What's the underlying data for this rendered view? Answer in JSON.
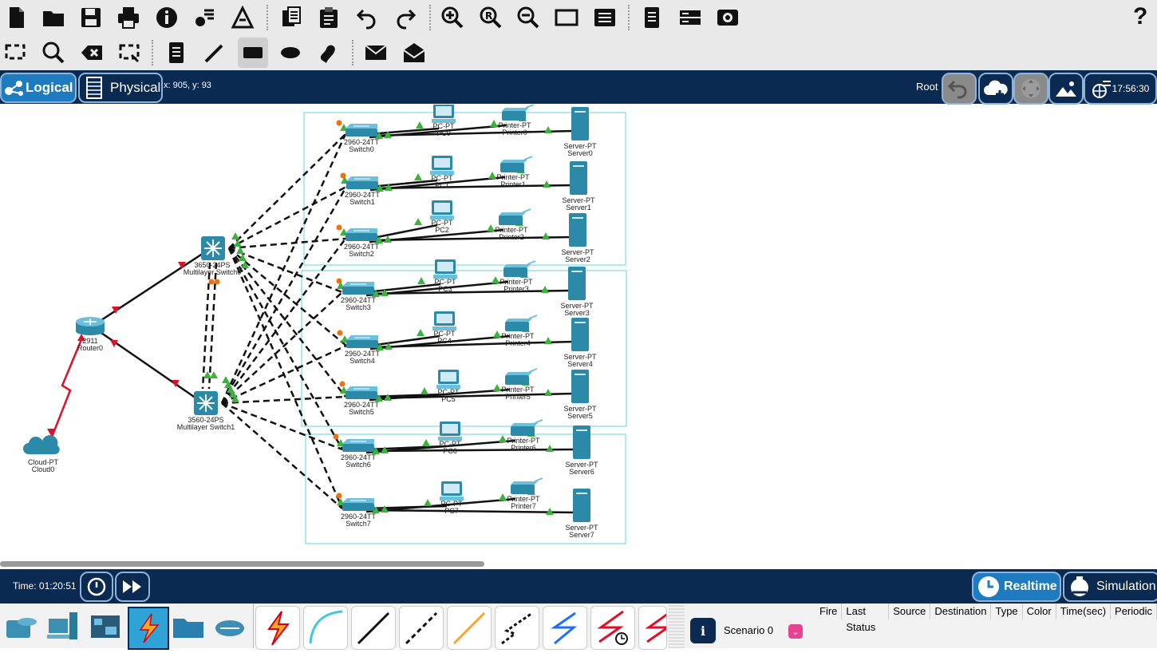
{
  "toolbar1": {
    "help_label": "?"
  },
  "topbar": {
    "logical_label": "Logical",
    "physical_label": "Physical",
    "coords": "x: 905, y: 93",
    "root_label": "Root",
    "clock": "17:56:30"
  },
  "devices": [
    {
      "id": "switch0",
      "model": "2960-24TT",
      "name": "Switch0"
    },
    {
      "id": "switch1",
      "model": "2960-24TT",
      "name": "Switch1"
    },
    {
      "id": "switch2",
      "model": "2960-24TT",
      "name": "Switch2"
    },
    {
      "id": "switch3",
      "model": "2960-24TT",
      "name": "Switch3"
    },
    {
      "id": "switch4",
      "model": "2960-24TT",
      "name": "Switch4"
    },
    {
      "id": "switch5",
      "model": "2960-24TT",
      "name": "Switch5"
    },
    {
      "id": "switch6",
      "model": "2960-24TT",
      "name": "Switch6"
    },
    {
      "id": "switch7",
      "model": "2960-24TT",
      "name": "Switch7"
    },
    {
      "id": "pc0",
      "model": "PC-PT",
      "name": "PC0"
    },
    {
      "id": "pc1",
      "model": "PC-PT",
      "name": "PC1"
    },
    {
      "id": "pc2",
      "model": "PC-PT",
      "name": "PC2"
    },
    {
      "id": "pc3",
      "model": "PC-PT",
      "name": "PC3"
    },
    {
      "id": "pc4",
      "model": "PC-PT",
      "name": "PC4"
    },
    {
      "id": "pc5",
      "model": "PC-PT",
      "name": "PC5"
    },
    {
      "id": "pc6",
      "model": "PC-PT",
      "name": "PC6"
    },
    {
      "id": "pc7",
      "model": "PC-PT",
      "name": "PC7"
    },
    {
      "id": "printer0",
      "model": "Printer-PT",
      "name": "Printer0"
    },
    {
      "id": "printer1",
      "model": "Printer-PT",
      "name": "Printer1"
    },
    {
      "id": "printer2",
      "model": "Printer-PT",
      "name": "Printer2"
    },
    {
      "id": "printer3",
      "model": "Printer-PT",
      "name": "Printer3"
    },
    {
      "id": "printer4",
      "model": "Printer-PT",
      "name": "Printer4"
    },
    {
      "id": "printer5",
      "model": "Printer-PT",
      "name": "Printer5"
    },
    {
      "id": "printer6",
      "model": "Printer-PT",
      "name": "Printer6"
    },
    {
      "id": "printer7",
      "model": "Printer-PT",
      "name": "Printer7"
    },
    {
      "id": "server0",
      "model": "Server-PT",
      "name": "Server0"
    },
    {
      "id": "server1",
      "model": "Server-PT",
      "name": "Server1"
    },
    {
      "id": "server2",
      "model": "Server-PT",
      "name": "Server2"
    },
    {
      "id": "server3",
      "model": "Server-PT",
      "name": "Server3"
    },
    {
      "id": "server4",
      "model": "Server-PT",
      "name": "Server4"
    },
    {
      "id": "server5",
      "model": "Server-PT",
      "name": "Server5"
    },
    {
      "id": "server6",
      "model": "Server-PT",
      "name": "Server6"
    },
    {
      "id": "server7",
      "model": "Server-PT",
      "name": "Server7"
    },
    {
      "id": "mls0",
      "model": "3650-24PS",
      "name": "Multilayer Switch0"
    },
    {
      "id": "mls1",
      "model": "3560-24PS",
      "name": "Multilayer Switch1"
    },
    {
      "id": "router0",
      "model": "2911",
      "name": "Router0"
    },
    {
      "id": "cloud0",
      "model": "Cloud-PT",
      "name": "Cloud0"
    }
  ],
  "bottombar": {
    "time_label": "Time: 01:20:51",
    "realtime_label": "Realtime",
    "simulation_label": "Simulation"
  },
  "scenario": {
    "info_icon": "i",
    "label": "Scenario 0"
  },
  "pdu_columns": [
    "Fire",
    "Last Status",
    "Source",
    "Destination",
    "Type",
    "Color",
    "Time(sec)",
    "Periodic"
  ],
  "colors": {
    "navy": "#0b2a52",
    "accent": "#1f7bbf",
    "link_up": "#3cb43c",
    "link_wait": "#f07010",
    "link_down": "#e0102a",
    "device": "#2a8aa8"
  }
}
